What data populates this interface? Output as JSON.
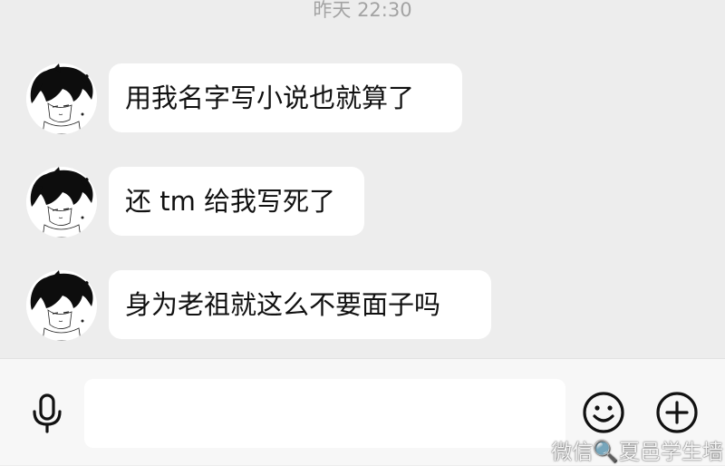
{
  "timestamp": "昨天 22:30",
  "messages": [
    {
      "text": "用我名字写小说也就算了"
    },
    {
      "text": "还 tm 给我写死了"
    },
    {
      "text": "身为老祖就这么不要面子吗"
    }
  ],
  "input": {
    "value": "",
    "placeholder": ""
  },
  "icons": {
    "voice": "microphone-icon",
    "emoji": "smiley-icon",
    "more": "plus-circle-icon"
  },
  "watermark": "微信🔍夏邑学生墙",
  "colors": {
    "background": "#ededed",
    "bubble": "#ffffff",
    "input_bar": "#f7f7f7",
    "text": "#111111",
    "timestamp": "#a3a3a3"
  }
}
